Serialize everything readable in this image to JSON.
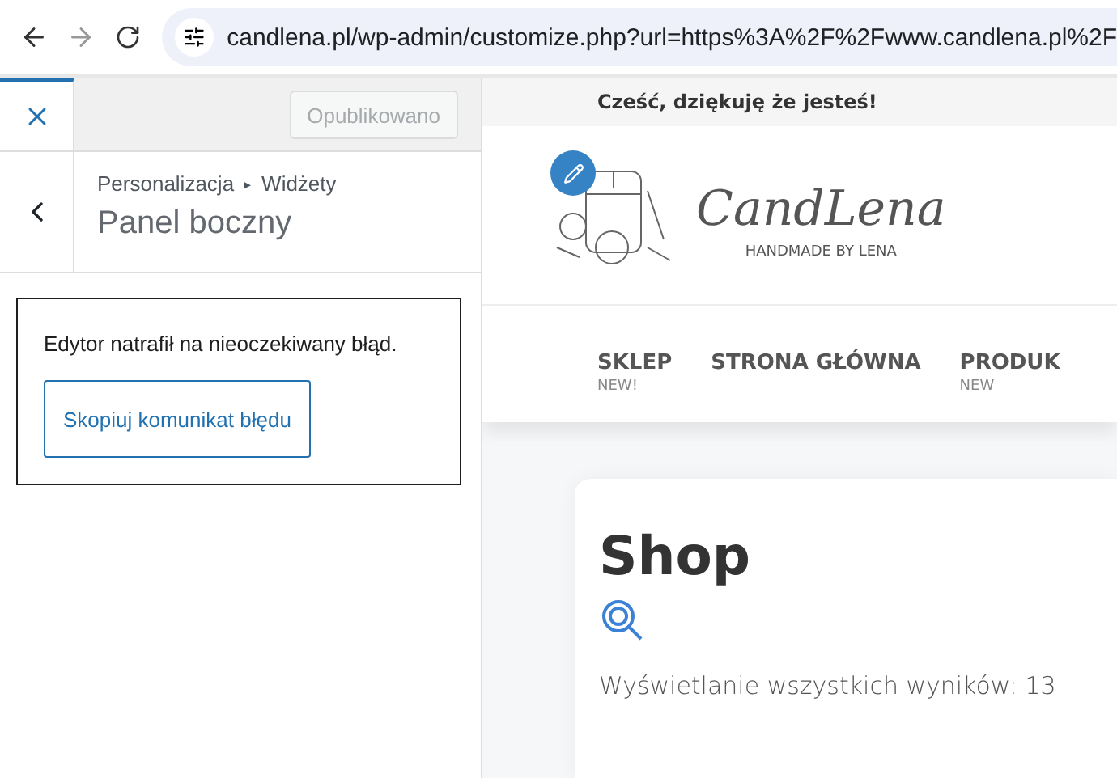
{
  "browser": {
    "url": "candlena.pl/wp-admin/customize.php?url=https%3A%2F%2Fwww.candlena.pl%2F"
  },
  "customizer": {
    "publish_button": {
      "label": "Opublikowano",
      "disabled": true
    },
    "breadcrumb": {
      "parent": "Personalizacja",
      "separator": "▸",
      "current": "Widżety"
    },
    "title": "Panel boczny",
    "error": {
      "message": "Edytor natrafił na nieoczekiwany błąd.",
      "button": "Skopiuj komunikat błędu"
    }
  },
  "preview": {
    "top_bar": "Cześć, dziękuję że jesteś!",
    "logo": {
      "name": "CandLena",
      "tagline": "HANDMADE BY LENA"
    },
    "nav": [
      {
        "label": "SKLEP",
        "badge": "NEW!"
      },
      {
        "label": "STRONA GŁÓWNA"
      },
      {
        "label": "PRODUK",
        "badge": "NEW"
      }
    ],
    "page": {
      "title": "Shop",
      "results": "Wyświetlanie wszystkich wyników: 13"
    }
  }
}
